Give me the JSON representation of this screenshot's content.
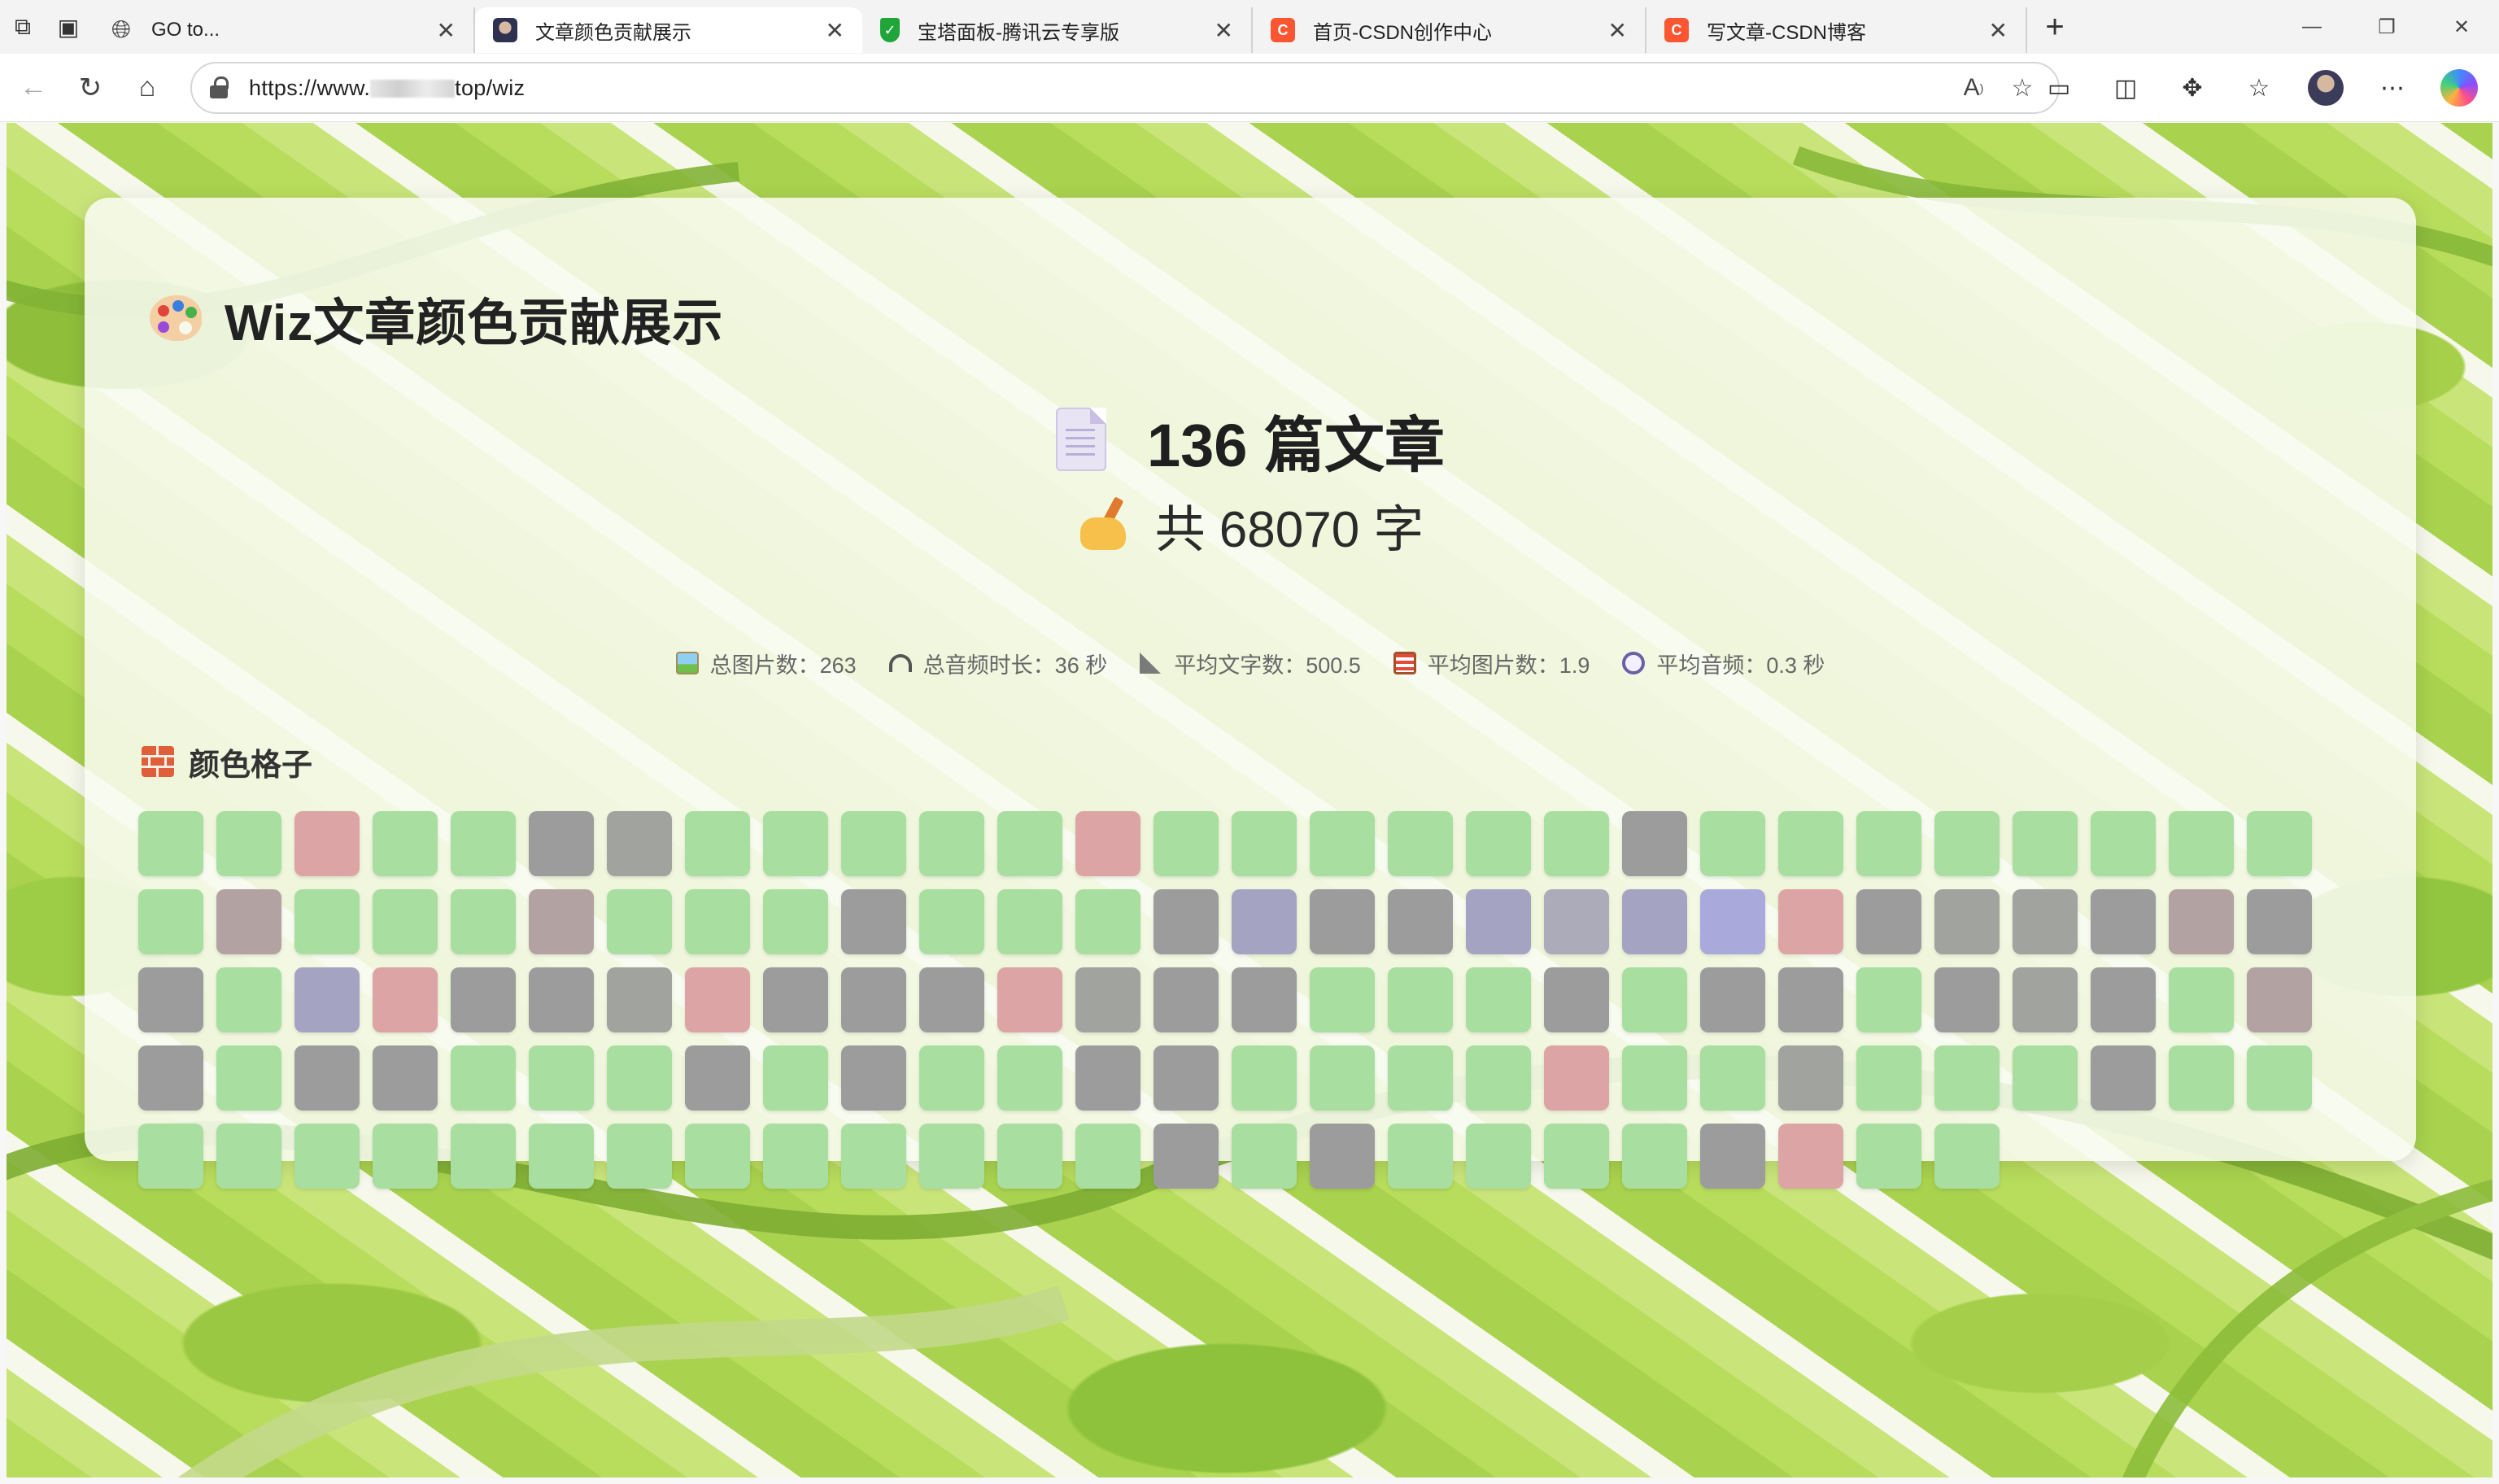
{
  "browser": {
    "tabs": [
      {
        "title": "GO to...",
        "favicon": "globe-icon",
        "active": false
      },
      {
        "title": "文章颜色贡献展示",
        "favicon": "anime-avatar-icon",
        "active": true
      },
      {
        "title": "宝塔面板-腾讯云专享版",
        "favicon": "bt-shield-icon",
        "active": false
      },
      {
        "title": "首页-CSDN创作中心",
        "favicon": "csdn-icon",
        "active": false
      },
      {
        "title": "写文章-CSDN博客",
        "favicon": "csdn-icon",
        "active": false
      }
    ],
    "url_prefix": "https://www.",
    "url_suffix": "top/wiz",
    "colors": {
      "tab_bar": "#f3f3f3",
      "csdn": "#fc5531",
      "bt_green": "#20a53a"
    }
  },
  "page": {
    "title": "Wiz文章颜色贡献展示",
    "article_count": "136 篇文章",
    "word_total": "共 68070 字",
    "stats": [
      {
        "icon": "picture-icon",
        "label": "总图片数：263"
      },
      {
        "icon": "headphones-icon",
        "label": "总音频时长：36 秒"
      },
      {
        "icon": "triangle-ruler-icon",
        "label": "平均文字数：500.5"
      },
      {
        "icon": "abacus-icon",
        "label": "平均图片数：1.9"
      },
      {
        "icon": "stopwatch-icon",
        "label": "平均音频：0.3 秒"
      }
    ],
    "grid_title": "颜色格子",
    "palette": {
      "G": "#a8dea0",
      "R": "#dca4a4",
      "D": "#9c9c9c",
      "S": "#a0a39e",
      "M": "#b3a2a2",
      "B": "#a4a4c2",
      "V": "#aaa9dc",
      "P": "#ababb9"
    },
    "grid_rows": [
      "GGRGGDSGGGGGRGGGGGGDGGGGGGGG",
      "GMGGGMGGGDGGGDBDDBPBVRDSSDMD",
      "DGBRDDSRDDDRSDDGGGDGDDGDSDGM",
      "DGDDGGGDGDGGDDGGGGRGGSGGGDGG",
      "GGGGGGGGGGGGGDGDGGGGDRGG"
    ]
  }
}
